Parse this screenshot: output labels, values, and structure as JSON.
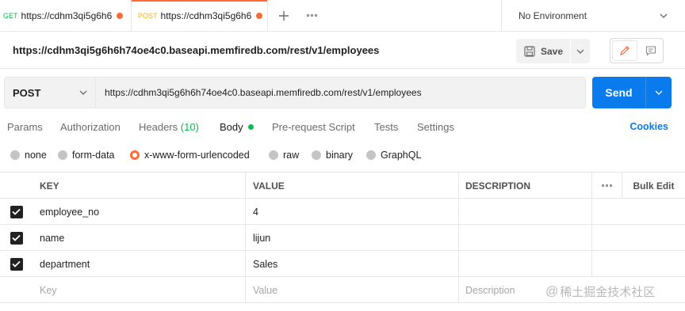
{
  "tabs": [
    {
      "method": "GET",
      "url": "https://cdhm3qi5g6h6",
      "unsaved": true
    },
    {
      "method": "POST",
      "url": "https://cdhm3qi5g6h6",
      "unsaved": true,
      "active": true
    }
  ],
  "environment": {
    "label": "No Environment"
  },
  "request": {
    "title": "https://cdhm3qi5g6h6h74oe4c0.baseapi.memfiredb.com/rest/v1/employees",
    "save_label": "Save",
    "method": "POST",
    "url": "https://cdhm3qi5g6h6h74oe4c0.baseapi.memfiredb.com/rest/v1/employees",
    "send_label": "Send"
  },
  "request_tabs": {
    "params": "Params",
    "authorization": "Authorization",
    "headers": "Headers",
    "headers_count": "(10)",
    "body": "Body",
    "pre_request": "Pre-request Script",
    "tests": "Tests",
    "settings": "Settings",
    "cookies": "Cookies",
    "active": "Body"
  },
  "body_types": {
    "none": "none",
    "form_data": "form-data",
    "urlencoded": "x-www-form-urlencoded",
    "raw": "raw",
    "binary": "binary",
    "graphql": "GraphQL",
    "selected": "x-www-form-urlencoded"
  },
  "table": {
    "headers": {
      "key": "KEY",
      "value": "VALUE",
      "description": "DESCRIPTION",
      "bulk_edit": "Bulk Edit"
    },
    "rows": [
      {
        "checked": true,
        "key": "employee_no",
        "value": "4",
        "description": ""
      },
      {
        "checked": true,
        "key": "name",
        "value": "lijun",
        "description": ""
      },
      {
        "checked": true,
        "key": "department",
        "value": "Sales",
        "description": ""
      }
    ],
    "placeholders": {
      "key": "Key",
      "value": "Value",
      "description": "Description"
    }
  },
  "watermark": "稀土掘金技术社区",
  "colors": {
    "accent": "#ff6c37",
    "send": "#097bed",
    "success": "#0cbb52",
    "post": "#ffb400"
  }
}
